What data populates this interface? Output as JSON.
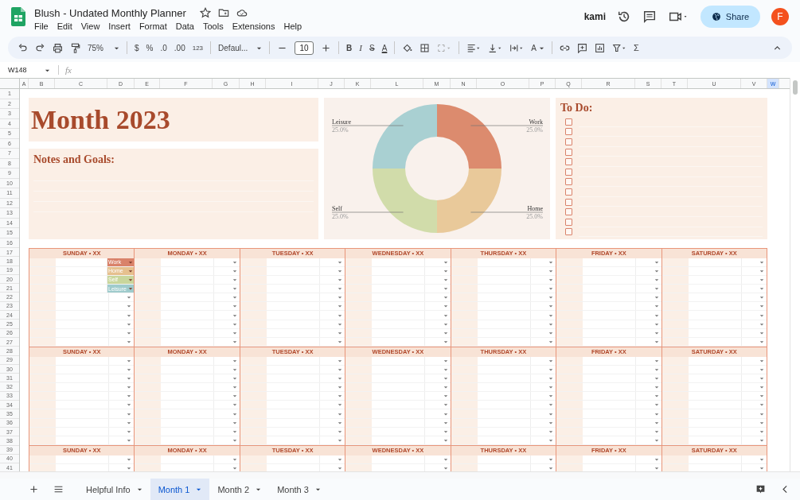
{
  "document": {
    "title": "Blush - Undated Monthly Planner"
  },
  "menu": [
    "File",
    "Edit",
    "View",
    "Insert",
    "Format",
    "Data",
    "Tools",
    "Extensions",
    "Help"
  ],
  "kami": "kami",
  "share_button": "Share",
  "avatar": "F",
  "toolbar": {
    "zoom": "75%",
    "currency": "$",
    "percent": "%",
    "decrease_decimals": ".0",
    "increase_decimals": ".00",
    "number_format": "123",
    "font": "Defaul...",
    "font_size": "10",
    "bold": "B",
    "italic": "I",
    "strikethrough": "S",
    "text_color": "A",
    "rotate": "A",
    "functions": "Σ"
  },
  "name_box": "W148",
  "formula_prefix": "fx",
  "columns": [
    {
      "label": "A",
      "selected": false
    },
    {
      "label": "B",
      "selected": false
    },
    {
      "label": "C",
      "selected": false
    },
    {
      "label": "D",
      "selected": false
    },
    {
      "label": "E",
      "selected": false
    },
    {
      "label": "F",
      "selected": false
    },
    {
      "label": "G",
      "selected": false
    },
    {
      "label": "H",
      "selected": false
    },
    {
      "label": "I",
      "selected": false
    },
    {
      "label": "J",
      "selected": false
    },
    {
      "label": "K",
      "selected": false
    },
    {
      "label": "L",
      "selected": false
    },
    {
      "label": "M",
      "selected": false
    },
    {
      "label": "N",
      "selected": false
    },
    {
      "label": "O",
      "selected": false
    },
    {
      "label": "P",
      "selected": false
    },
    {
      "label": "Q",
      "selected": false
    },
    {
      "label": "R",
      "selected": false
    },
    {
      "label": "S",
      "selected": false
    },
    {
      "label": "T",
      "selected": false
    },
    {
      "label": "U",
      "selected": false
    },
    {
      "label": "V",
      "selected": false
    },
    {
      "label": "W",
      "selected": true
    }
  ],
  "rows": [
    "1",
    "2",
    "3",
    "4",
    "5",
    "6",
    "7",
    "8",
    "9",
    "10",
    "11",
    "12",
    "13",
    "14",
    "15",
    "16",
    "17",
    "18",
    "19",
    "20",
    "21",
    "22",
    "23",
    "24",
    "25",
    "26",
    "27",
    "28",
    "29",
    "30",
    "31",
    "32",
    "33",
    "34",
    "35",
    "36",
    "37",
    "38",
    "39",
    "40",
    "41"
  ],
  "sheet": {
    "title": "Month 2023",
    "notes_heading": "Notes and Goals:",
    "chart_data": {
      "type": "donut",
      "categories": [
        "Work",
        "Home",
        "Self",
        "Leisure"
      ],
      "values": [
        25,
        25,
        25,
        25
      ],
      "value_labels": [
        "25.0%",
        "25.0%",
        "25.0%",
        "25.0%"
      ]
    },
    "todo": {
      "heading": "To Do:",
      "items": [
        {
          "checked": false
        },
        {
          "checked": false
        },
        {
          "checked": false
        },
        {
          "checked": false
        },
        {
          "checked": false
        },
        {
          "checked": false
        },
        {
          "checked": false
        },
        {
          "checked": false
        },
        {
          "checked": false
        },
        {
          "checked": false
        },
        {
          "checked": false
        },
        {
          "checked": false
        }
      ]
    },
    "weeks": [
      {
        "days": [
          {
            "label": "SUNDAY • XX",
            "chips": [
              {
                "label": "Work",
                "color": "#d9826a"
              },
              {
                "label": "Home",
                "color": "#e6c08e"
              },
              {
                "label": "Self",
                "color": "#c9d69c"
              },
              {
                "label": "Leisure",
                "color": "#9fcbcc"
              }
            ]
          },
          {
            "label": "MONDAY • XX"
          },
          {
            "label": "TUESDAY • XX"
          },
          {
            "label": "WEDNESDAY • XX"
          },
          {
            "label": "THURSDAY • XX"
          },
          {
            "label": "FRIDAY • XX"
          },
          {
            "label": "SATURDAY • XX"
          }
        ],
        "slots": [
          {
            "kind": "dropdown"
          },
          {
            "kind": "dropdown"
          },
          {
            "kind": "dropdown"
          },
          {
            "kind": "dropdown"
          },
          {
            "kind": "dropdown"
          },
          {
            "kind": "dropdown"
          },
          {
            "kind": "dropdown"
          },
          {
            "kind": "dropdown"
          },
          {
            "kind": "dropdown"
          },
          {
            "kind": "dropdown"
          }
        ]
      },
      {
        "days": [
          {
            "label": "SUNDAY • XX"
          },
          {
            "label": "MONDAY • XX"
          },
          {
            "label": "TUESDAY • XX"
          },
          {
            "label": "WEDNESDAY • XX"
          },
          {
            "label": "THURSDAY • XX"
          },
          {
            "label": "FRIDAY • XX"
          },
          {
            "label": "SATURDAY • XX"
          }
        ],
        "slots": [
          {
            "kind": "dropdown"
          },
          {
            "kind": "dropdown"
          },
          {
            "kind": "dropdown"
          },
          {
            "kind": "dropdown"
          },
          {
            "kind": "dropdown"
          },
          {
            "kind": "dropdown"
          },
          {
            "kind": "dropdown"
          },
          {
            "kind": "dropdown"
          },
          {
            "kind": "dropdown"
          },
          {
            "kind": "dropdown"
          }
        ]
      },
      {
        "days": [
          {
            "label": "SUNDAY • XX"
          },
          {
            "label": "MONDAY • XX"
          },
          {
            "label": "TUESDAY • XX"
          },
          {
            "label": "WEDNESDAY • XX"
          },
          {
            "label": "THURSDAY • XX"
          },
          {
            "label": "FRIDAY • XX"
          },
          {
            "label": "SATURDAY • XX"
          }
        ],
        "slots": [
          {
            "kind": "dropdown"
          },
          {
            "kind": "dropdown"
          }
        ]
      }
    ]
  },
  "tabs": [
    {
      "label": "Helpful Info",
      "selected": false
    },
    {
      "label": "Month 1",
      "selected": true
    },
    {
      "label": "Month 2",
      "selected": false
    },
    {
      "label": "Month 3",
      "selected": false
    }
  ]
}
